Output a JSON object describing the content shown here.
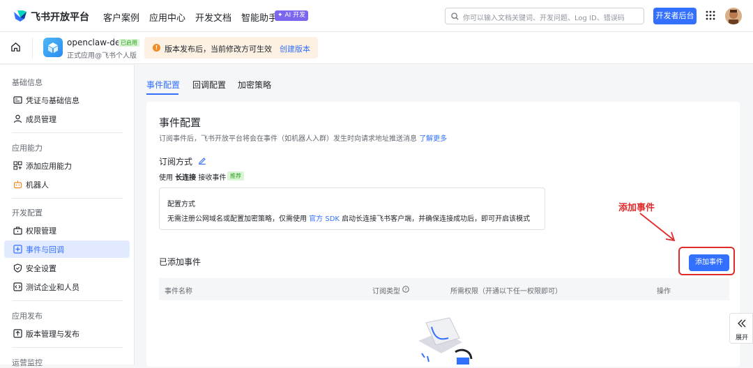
{
  "topnav": {
    "brand": "飞书开放平台",
    "items": [
      "客户案例",
      "应用中心",
      "开发文档",
      "智能助手"
    ],
    "ai_tag": "✦ AI 开发",
    "search_placeholder": "你可以输入文档关键词、开发问题、Log ID、错误码",
    "dev_button": "开发者后台"
  },
  "appbar": {
    "app_name": "openclaw-dev",
    "status_badge": "已启用",
    "app_sub": "正式应用@飞书个人版",
    "notice_text": "版本发布后，当前修改方可生效",
    "notice_link": "创建版本"
  },
  "sidebar": {
    "sections": [
      "基础信息",
      "应用能力",
      "开发配置",
      "应用发布",
      "运营监控"
    ],
    "items": [
      "凭证与基础信息",
      "成员管理",
      "添加应用能力",
      "机器人",
      "权限管理",
      "事件与回调",
      "安全设置",
      "测试企业和人员",
      "版本管理与发布"
    ]
  },
  "tabs": [
    "事件配置",
    "回调配置",
    "加密策略"
  ],
  "main": {
    "title": "事件配置",
    "desc": "订阅事件后，飞书开放平台将会在事件（如机器人入群）发生时向请求地址推送消息",
    "desc_link": "了解更多",
    "sub_title": "订阅方式",
    "uses_prefix": "使用",
    "uses_bold": "长连接",
    "uses_suffix": "接收事件",
    "recommend": "推荐",
    "cfg_title": "配置方式",
    "cfg_desc_1": "无需注册公网域名或配置加密策略，仅需使用",
    "cfg_link": "官方 SDK",
    "cfg_desc_2": "启动长连接飞书客户端，并确保连接成功后，即可开启该模式",
    "added_title": "已添加事件",
    "add_button": "添加事件",
    "annotation": "添加事件",
    "columns": [
      "事件名称",
      "订阅类型",
      "所需权限（开通以下任一权限即可）",
      "操作"
    ]
  },
  "expand_label": "展开",
  "colors": {
    "accent": "#3370ff",
    "annotation": "#e02b2b",
    "notice_bg": "#fdf1e3"
  }
}
